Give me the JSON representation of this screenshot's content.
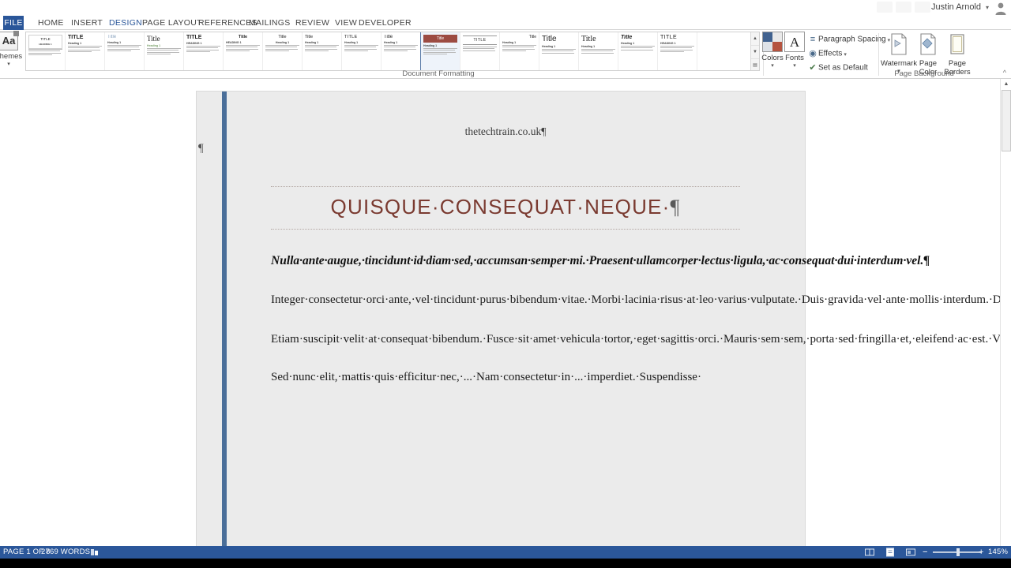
{
  "window": {
    "user_name": "Justin Arnold",
    "user_caret": "▾"
  },
  "tabs": [
    {
      "label": "FILE",
      "active": false,
      "file": true
    },
    {
      "label": "HOME",
      "active": false
    },
    {
      "label": "INSERT",
      "active": false
    },
    {
      "label": "DESIGN",
      "active": true
    },
    {
      "label": "PAGE LAYOUT",
      "active": false
    },
    {
      "label": "REFERENCES",
      "active": false
    },
    {
      "label": "MAILINGS",
      "active": false
    },
    {
      "label": "REVIEW",
      "active": false
    },
    {
      "label": "VIEW",
      "active": false
    },
    {
      "label": "DEVELOPER",
      "active": false
    }
  ],
  "ribbon": {
    "themes": {
      "icon": "themes-icon",
      "glyph": "Aa",
      "label": "Themes",
      "caret": "▾"
    },
    "document_formatting_label": "Document Formatting",
    "gallery": [
      {
        "title": "TITLE",
        "heading": "HEADING 1",
        "style": "boxed",
        "selected": false
      },
      {
        "title": "TITLE",
        "heading": "Heading 1",
        "style": "plain",
        "selected": false
      },
      {
        "title": "Title",
        "heading": "Heading 1",
        "style": "light",
        "selected": false
      },
      {
        "title": "Title",
        "heading": "Heading 1",
        "style": "serif",
        "selected": false
      },
      {
        "title": "TITLE",
        "heading": "HEADING 1",
        "style": "bold",
        "selected": false
      },
      {
        "title": "Title",
        "heading": "HEADING 1",
        "style": "centered",
        "selected": false
      },
      {
        "title": "Title",
        "heading": "Heading 1",
        "style": "center2",
        "selected": false
      },
      {
        "title": "Title",
        "heading": "Heading 1",
        "style": "left",
        "selected": false
      },
      {
        "title": "TITLE",
        "heading": "Heading 1",
        "style": "caps",
        "selected": false
      },
      {
        "title": "Title",
        "heading": "Heading 1",
        "style": "plain2",
        "selected": false
      },
      {
        "title": "Title",
        "heading": "Heading 1",
        "style": "banner",
        "selected": true
      },
      {
        "title": "TITLE",
        "heading": "Heading 1",
        "style": "ruled",
        "selected": false
      },
      {
        "title": "Title",
        "heading": "Heading 1",
        "style": "tmz",
        "selected": false
      },
      {
        "title": "Title",
        "heading": "Heading 1",
        "style": "big",
        "selected": false
      },
      {
        "title": "Title",
        "heading": "Heading 1",
        "style": "big2",
        "selected": false
      },
      {
        "title": "Title",
        "heading": "Heading 1",
        "style": "italic",
        "selected": false
      },
      {
        "title": "TITLE",
        "heading": "HEADING 1",
        "style": "caps2",
        "selected": false
      }
    ],
    "gallery_scroll": {
      "up": "▲",
      "down": "▼",
      "more": "▤"
    },
    "colors": {
      "label": "Colors",
      "caret": "▾",
      "swatches": [
        "#41628f",
        "#e9e9e9",
        "#dfe3e8",
        "#b5533f"
      ]
    },
    "fonts": {
      "label": "Fonts",
      "caret": "▾",
      "glyph": "A"
    },
    "commands": [
      {
        "label": "Paragraph Spacing",
        "icon": "paragraph-spacing-icon",
        "glyph": "≡",
        "dropdown": "▾"
      },
      {
        "label": "Effects",
        "icon": "effects-icon",
        "glyph": "◉",
        "dropdown": "▾"
      },
      {
        "label": "Set as Default",
        "icon": "set-default-icon",
        "glyph": "✔",
        "dropdown": ""
      }
    ],
    "page_background": {
      "label": "Page Background",
      "buttons": [
        {
          "label": "Watermark",
          "icon": "watermark-icon",
          "caret": "▾"
        },
        {
          "label": "Page\nColor",
          "label_line1": "Page",
          "label_line2": "Color",
          "icon": "page-color-icon",
          "caret": "▾"
        },
        {
          "label": "Page\nBorders",
          "label_line1": "Page",
          "label_line2": "Borders",
          "icon": "page-borders-icon",
          "caret": ""
        }
      ],
      "dialog_launcher": "⌐"
    },
    "collapse": "^"
  },
  "document": {
    "header": "thetechtrain.co.uk¶",
    "empty_paragraph": "¶",
    "title": "QUISQUE·CONSEQUAT·NEQUE·",
    "title_pilcrow": "¶",
    "subtitle": "Nulla·ante·augue,·tincidunt·id·diam·sed,·accumsan·semper·mi.·Praesent·ullamcorper·lectus·ligula,·ac·consequat·dui·interdum·vel.¶",
    "paragraphs": [
      "Integer·consectetur·orci·ante,·vel·tincidunt·purus·bibendum·vitae.·Morbi·lacinia·risus·at·leo·varius·vulputate.·Duis·gravida·vel·ante·mollis·interdum.·Duis·at·eleifend·ante,·eu·interdum·leo.·Ut·aliquam·est·id·odio·dictum·cursus.·In·sodales·hendrerit·nunc,·in·gravida·libero·cursus·sed.·Donec·aliquam·porttitor·porttitor.·In·vitae·vestibulum·velit.·¶",
      "Etiam·suscipit·velit·at·consequat·bibendum.·Fusce·sit·amet·vehicula·tortor,·eget·sagittis·orci.·Mauris·sem·sem,·porta·sed·fringilla·et,·eleifend·ac·est.·Vestibulum·pulvinar·odio·id·ex·feugiat·iaculis.·Integer·pretium·eros·a·risus·ornare·tincidunt.·Suspendisse·ut·velit·suscipit·ipsum·venenatis·congue·ut·at·est.·Phasellus·congue·magna·arcu,·quis·fringilla·nulla·suscipit·vitae.·Fusce·elementum·purus·ac·luctus·laoreet.·Fusce·sed·finibus·augue,·quis·posuere·velit.·Suspendisse·eu·risus·justo.·¶",
      "Sed·nunc·elit,·mattis·quis·efficitur·nec,·...·Nam·consectetur·in·...·imperdiet.·Suspendisse·"
    ]
  },
  "scrollbar": {
    "up": "▲",
    "down": "▼"
  },
  "statusbar": {
    "page": "PAGE 1 OF 8",
    "words": "2769 WORDS",
    "proofing_icon": "proofing-icon",
    "view_buttons": [
      {
        "name": "read-mode-icon",
        "glyph": "▤"
      },
      {
        "name": "print-layout-icon",
        "glyph": "▣"
      },
      {
        "name": "web-layout-icon",
        "glyph": "▧"
      }
    ],
    "zoom_out": "−",
    "zoom_in": "+",
    "zoom_level": "145%"
  },
  "colors": {
    "accent_blue": "#2b579a",
    "title_maroon": "#7a3a30",
    "change_bar": "#4a6e99",
    "page_bg": "#ebebeb"
  }
}
